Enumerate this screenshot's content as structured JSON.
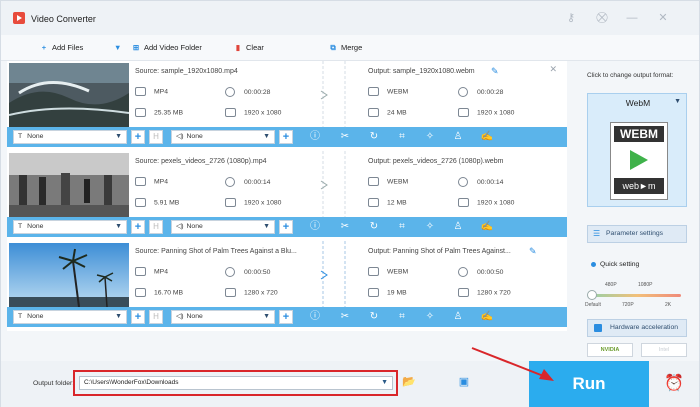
{
  "app": {
    "title": "Video Converter"
  },
  "window_controls": {
    "key": "⚷",
    "cart": "⛒",
    "minimize": "—",
    "close": "✕"
  },
  "toolbar": {
    "add_files": "Add Files",
    "add_video_folder": "Add Video Folder",
    "clear": "Clear",
    "merge": "Merge"
  },
  "files": [
    {
      "source_title": "Source: sample_1920x1080.mp4",
      "src_format": "MP4",
      "src_duration": "00:00:28",
      "src_size": "25.35 MB",
      "src_res": "1920 x 1080",
      "output_title": "Output: sample_1920x1080.webm",
      "out_format": "WEBM",
      "out_duration": "00:00:28",
      "out_size": "24 MB",
      "out_res": "1920 x 1080",
      "subtitle": "None",
      "audio": "None"
    },
    {
      "source_title": "Source: pexels_videos_2726 (1080p).mp4",
      "src_format": "MP4",
      "src_duration": "00:00:14",
      "src_size": "5.91 MB",
      "src_res": "1920 x 1080",
      "output_title": "Output: pexels_videos_2726 (1080p).webm",
      "out_format": "WEBM",
      "out_duration": "00:00:14",
      "out_size": "12 MB",
      "out_res": "1920 x 1080",
      "subtitle": "None",
      "audio": "None"
    },
    {
      "source_title": "Source: Panning Shot of Palm Trees Against a Blu...",
      "src_format": "MP4",
      "src_duration": "00:00:50",
      "src_size": "16.70 MB",
      "src_res": "1280 x 720",
      "output_title": "Output: Panning Shot of Palm Trees Against...",
      "out_format": "WEBM",
      "out_duration": "00:00:50",
      "out_size": "19 MB",
      "out_res": "1280 x 720",
      "subtitle": "None",
      "audio": "None"
    }
  ],
  "right_panel": {
    "hint": "Click to change output format:",
    "format": "WebM",
    "logo_top": "WEBM",
    "logo_bottom": "web►m",
    "parameter_settings": "Parameter settings",
    "quick_setting": "Quick setting",
    "ticks_top": [
      "480P",
      "1080P"
    ],
    "ticks_bottom": [
      "Default",
      "720P",
      "2K"
    ],
    "hardware_acceleration": "Hardware acceleration",
    "nvidia": "NVIDIA",
    "intel": "Intel"
  },
  "bottom": {
    "output_folder_label": "Output folder:",
    "output_folder_value": "C:\\Users\\WonderFox\\Downloads",
    "run": "Run"
  },
  "colors": {
    "accent": "#2bacee",
    "bar": "#5bb4ea",
    "highlight": "#d9262a"
  }
}
